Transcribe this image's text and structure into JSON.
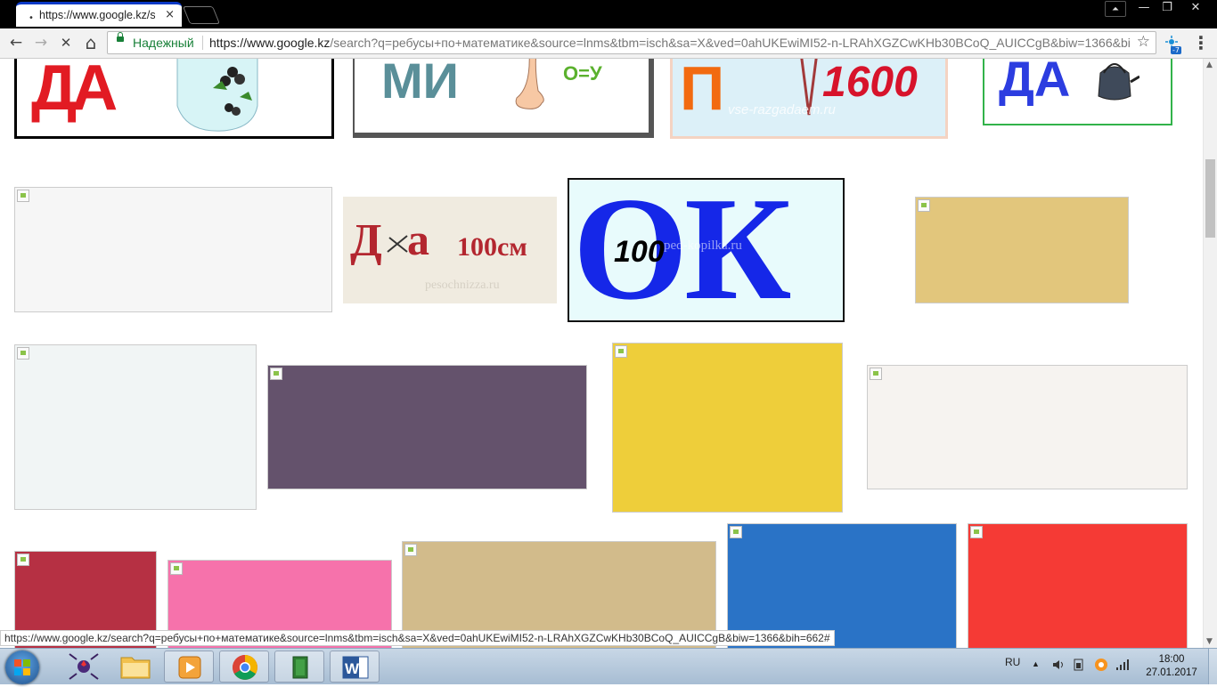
{
  "browser": {
    "tab_title": "https://www.google.kz/sear",
    "tab_close": "×",
    "window_controls": {
      "user": "⏶",
      "minimize": "—",
      "restore": "❐",
      "close": "✕"
    },
    "nav": {
      "back": "←",
      "forward": "→",
      "stop": "✕",
      "home": "⌂"
    },
    "secure_label": "Надежный",
    "url_host": "https://www.google.kz",
    "url_rest": "/search?q=ребусы+по+математике&source=lnms&tbm=isch&sa=X&ved=0ahUKEwiMI52-n-LRAhXGZCwKHb30BCoQ_AUICCgB&biw=1366&bi",
    "star": "☆",
    "ext_badge": "-7",
    "menu": "⋮",
    "status_url": "https://www.google.kz/search?q=ребусы+по+математике&source=lnms&tbm=isch&sa=X&ved=0ahUKEwiMI52-n-LRAhXGZCwKHb30BCoQ_AUICCgB&biw=1366&bih=662#"
  },
  "results": {
    "row1": {
      "tile1_text": "ДА",
      "tile2_text": "МИ",
      "tile2_eq": "О=У",
      "tile3_letter": "П",
      "tile3_num": "1600",
      "tile3_watermark": "vse-razgadaem.ru",
      "tile4_text": "ДА"
    },
    "row2": {
      "puzzle1_text": "Д",
      "puzzle1_a": "а",
      "puzzle1_num": "100см",
      "puzzle1_watermark": "pesochnizza.ru",
      "puzzle2_text": "ОК",
      "puzzle2_num": "100",
      "puzzle2_watermark": "ped-kopilka.ru"
    },
    "placeholder_colors": [
      "#f6f6f6",
      "#e2c67c",
      "#f1f5f5",
      "#64526c",
      "#eece3a",
      "#f6f3f0",
      "#b63043",
      "#f672ab",
      "#d2bb8b",
      "#2a73c6",
      "#f53a35"
    ]
  },
  "taskbar": {
    "apps": [
      "spider-solitaire",
      "file-explorer",
      "media-player",
      "chrome",
      "file-manager",
      "word"
    ],
    "lang": "RU",
    "time": "18:00",
    "date": "27.01.2017"
  }
}
